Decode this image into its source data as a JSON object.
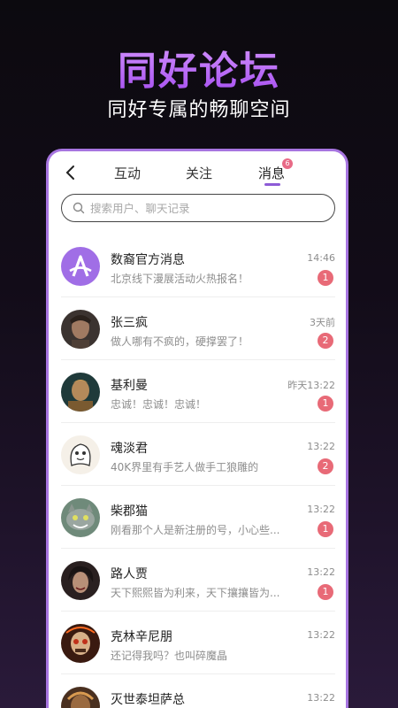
{
  "hero": {
    "title": "同好论坛",
    "subtitle": "同好专属的畅聊空间"
  },
  "tabs": [
    {
      "label": "互动"
    },
    {
      "label": "关注"
    },
    {
      "label": "消息",
      "badge": "6"
    }
  ],
  "search": {
    "placeholder": "搜索用户、聊天记录"
  },
  "messages": [
    {
      "name": "数裔官方消息",
      "preview": "北京线下漫展活动火热报名！",
      "time": "14:46",
      "unread": "1",
      "avatar": "app-logo"
    },
    {
      "name": "张三疯",
      "preview": "做人哪有不疯的，硬撑罢了！",
      "time": "3天前",
      "unread": "2",
      "avatar": "man-portrait"
    },
    {
      "name": "基利曼",
      "preview": "忠诚！忠诚！忠诚！",
      "time": "昨天13:22",
      "unread": "1",
      "avatar": "warrior-portrait"
    },
    {
      "name": "魂淡君",
      "preview": "40K界里有手艺人做手工狼雕的",
      "time": "13:22",
      "unread": "2",
      "avatar": "ghost-cartoon"
    },
    {
      "name": "柴郡猫",
      "preview": "刚看那个人是新注册的号，小心些...",
      "time": "13:22",
      "unread": "1",
      "avatar": "cat-portrait"
    },
    {
      "name": "路人贾",
      "preview": "天下熙熙皆为利来，天下攘攘皆为...",
      "time": "13:22",
      "unread": "1",
      "avatar": "dark-portrait"
    },
    {
      "name": "克林辛尼朋",
      "preview": "还记得我吗？也叫碎魔晶",
      "time": "13:22",
      "unread": "",
      "avatar": "skull-portrait"
    },
    {
      "name": "灭世泰坦萨总",
      "preview": "",
      "time": "13:22",
      "unread": "",
      "avatar": "titan-portrait"
    }
  ],
  "colors": {
    "accent": "#a775e0",
    "badge": "#e86a77",
    "hero_title": "#c56cf0"
  }
}
